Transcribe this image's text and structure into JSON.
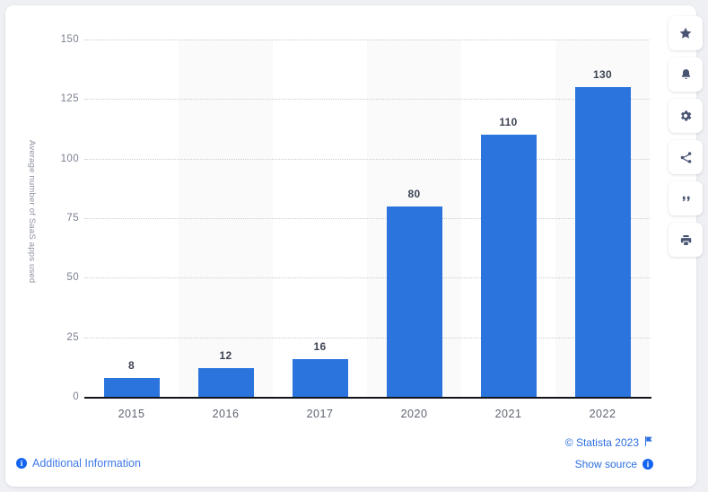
{
  "chart_data": {
    "type": "bar",
    "title": "",
    "subtitle": "",
    "xlabel": "",
    "ylabel": "Average number of SaaS apps used",
    "categories": [
      "2015",
      "2016",
      "2017",
      "2020",
      "2021",
      "2022"
    ],
    "values": [
      8,
      12,
      16,
      80,
      110,
      130
    ],
    "value_labels": [
      "8",
      "12",
      "16",
      "80",
      "110",
      "130"
    ],
    "ylim": [
      0,
      150
    ],
    "yticks": [
      0,
      25,
      50,
      75,
      100,
      125,
      150
    ],
    "ytick_labels": [
      "0",
      "25",
      "50",
      "75",
      "100",
      "125",
      "150"
    ],
    "grid": true,
    "grid_style": "horizontal-dotted",
    "legend": false,
    "legend_position": "none",
    "bar_color": "#2b74dd",
    "label_color": "#3c4352",
    "axis_color": "#111418",
    "band_color": "#fafafa"
  },
  "footer": {
    "additional_information": "Additional Information",
    "copyright": "© Statista 2023",
    "show_source": "Show source",
    "info_glyph": "i"
  },
  "rail": {
    "items": [
      {
        "name": "favorite-star-icon",
        "label": "Favorite"
      },
      {
        "name": "notification-bell-icon",
        "label": "Notifications"
      },
      {
        "name": "settings-gear-icon",
        "label": "Settings"
      },
      {
        "name": "share-icon",
        "label": "Share"
      },
      {
        "name": "citation-quote-icon",
        "label": "Cite"
      },
      {
        "name": "print-icon",
        "label": "Print"
      }
    ]
  }
}
